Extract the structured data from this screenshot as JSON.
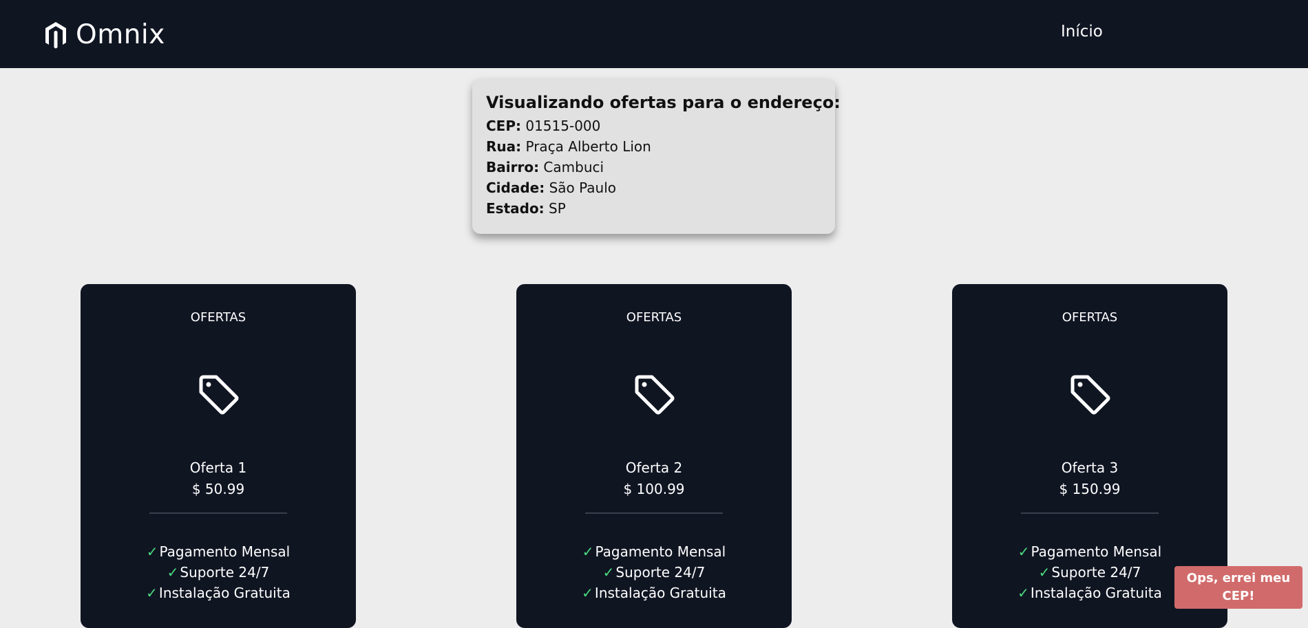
{
  "header": {
    "brand_name": "Omnix",
    "brand_icon": "magento-m-logo",
    "nav_link": "Início"
  },
  "address": {
    "title": "Visualizando ofertas para o endereço:",
    "fields": [
      {
        "label": "CEP:",
        "value": "01515-000"
      },
      {
        "label": "Rua:",
        "value": "Praça Alberto Lion"
      },
      {
        "label": "Bairro:",
        "value": "Cambuci"
      },
      {
        "label": "Cidade:",
        "value": "São Paulo"
      },
      {
        "label": "Estado:",
        "value": "SP"
      }
    ]
  },
  "offers": [
    {
      "label": "OFERTAS",
      "icon": "tag-icon",
      "name": "Oferta 1",
      "price": "$ 50.99",
      "features": [
        "Pagamento Mensal",
        "Suporte 24/7",
        "Instalação Gratuita"
      ]
    },
    {
      "label": "OFERTAS",
      "icon": "tag-icon",
      "name": "Oferta 2",
      "price": "$ 100.99",
      "features": [
        "Pagamento Mensal",
        "Suporte 24/7",
        "Instalação Gratuita"
      ]
    },
    {
      "label": "OFERTAS",
      "icon": "tag-icon",
      "name": "Oferta 3",
      "price": "$ 150.99",
      "features": [
        "Pagamento Mensal",
        "Suporte 24/7",
        "Instalação Gratuita"
      ]
    }
  ],
  "fix_button": {
    "label": "Ops, errei meu CEP!"
  },
  "colors": {
    "navbar": "#101522",
    "page_background": "#ededed",
    "address_card": "#e1e1e1",
    "check": "#4ade80",
    "fix_button": "#d16b6b"
  }
}
